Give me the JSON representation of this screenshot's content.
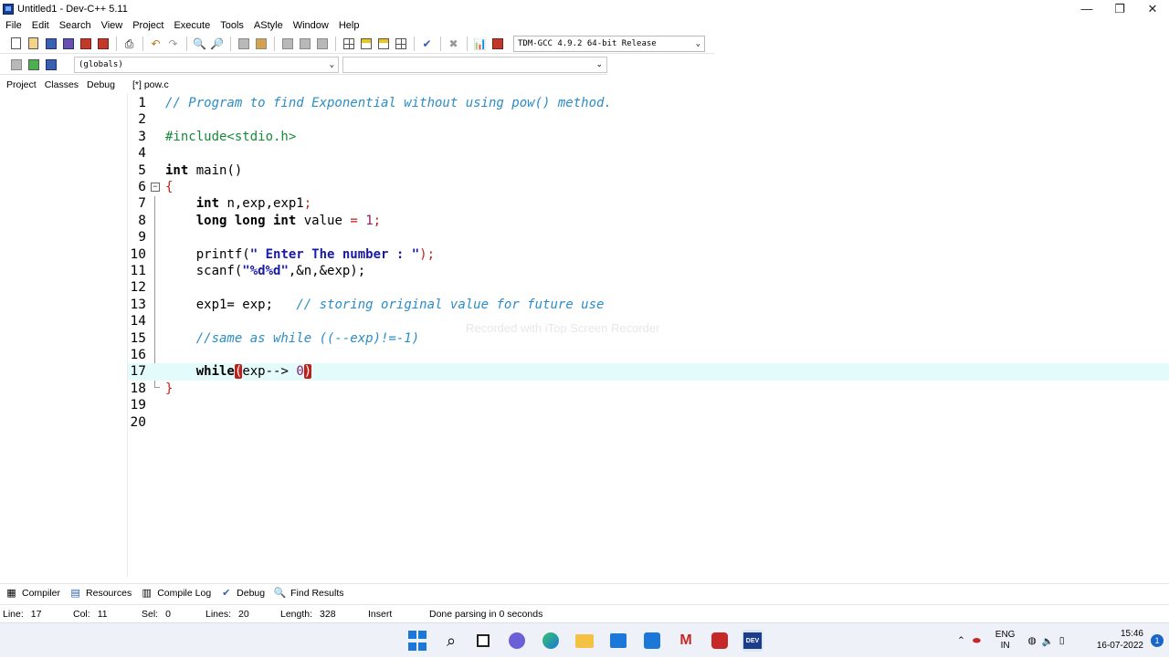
{
  "window": {
    "title": "Untitled1 - Dev-C++ 5.11",
    "controls": {
      "minimize": "—",
      "maximize": "❐",
      "close": "✕"
    }
  },
  "menu": [
    "File",
    "Edit",
    "Search",
    "View",
    "Project",
    "Execute",
    "Tools",
    "AStyle",
    "Window",
    "Help"
  ],
  "toolbar": {
    "compiler": "TDM-GCC 4.9.2 64-bit Release",
    "scope": "(globals)",
    "member": ""
  },
  "left_tabs": [
    "Project",
    "Classes",
    "Debug"
  ],
  "editor": {
    "tab": "[*] pow.c",
    "line_numbers": [
      "1",
      "2",
      "3",
      "4",
      "5",
      "6",
      "7",
      "8",
      "9",
      "10",
      "11",
      "12",
      "13",
      "14",
      "15",
      "16",
      "17",
      "18",
      "19",
      "20"
    ],
    "lines": {
      "l1": "// Program to find Exponential without using pow() method.",
      "l3": "#include<stdio.h>",
      "l5_kw": "int",
      "l5_rest": " main()",
      "l6": "{",
      "l7_kw": "int",
      "l7_rest": " n,exp,exp1",
      "l7_semi": ";",
      "l8_kw": "long long int",
      "l8_rest": " value ",
      "l8_eq": "=",
      "l8_num": "1",
      "l8_semi": ";",
      "l10_fn": "printf(",
      "l10_str": "\" Enter The number : \"",
      "l10_end": ");",
      "l11_fn": "scanf(",
      "l11_str": "\"%d%d\"",
      "l11_end": ",&n,&exp);",
      "l13_code": "exp1= exp;",
      "l13_cm": "// storing original value for future use",
      "l15": "//same as while ((--exp)!=-1)",
      "l17_kw": "while",
      "l17_open": "(",
      "l17_mid": "exp--> ",
      "l17_num": "0",
      "l17_close": ")",
      "l18": "}"
    }
  },
  "watermark": "Recorded with iTop Screen Recorder",
  "bottom_tabs": [
    "Compiler",
    "Resources",
    "Compile Log",
    "Debug",
    "Find Results"
  ],
  "status": {
    "line_label": "Line:",
    "line": "17",
    "col_label": "Col:",
    "col": "11",
    "sel_label": "Sel:",
    "sel": "0",
    "lines_label": "Lines:",
    "lines": "20",
    "length_label": "Length:",
    "length": "328",
    "mode": "Insert",
    "message": "Done parsing in 0 seconds"
  },
  "taskbar": {
    "lang": "ENG",
    "region": "IN",
    "time": "15:46",
    "date": "16-07-2022",
    "notifications": "1",
    "dev_label": "DEV"
  },
  "colors": {
    "comment": "#2a8cc8",
    "preprocessor": "#178a3a",
    "string": "#1a1aa8",
    "symbol": "#c0201a",
    "active_line": "#e3fbfb"
  }
}
